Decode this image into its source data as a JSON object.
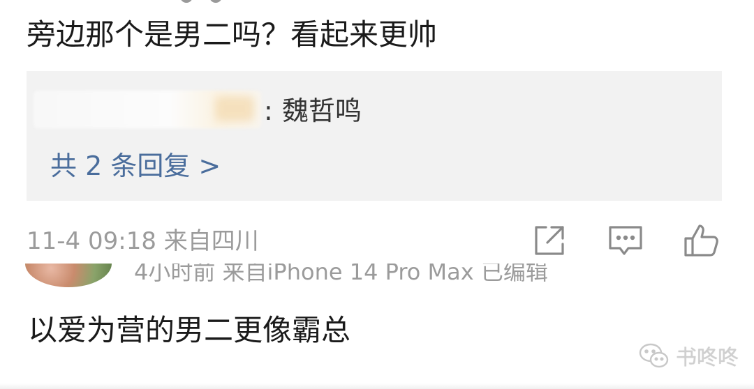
{
  "comment": {
    "text": "旁边那个是男二吗？看起来更帅",
    "reply_preview": {
      "separator": ":",
      "content": "魏哲鸣"
    },
    "reply_count_label": "共 2 条回复 >",
    "meta": "11-4 09:18  来自四川"
  },
  "actions": {
    "share_icon": "share-icon",
    "comment_icon": "comment-icon",
    "like_icon": "thumbs-up-icon"
  },
  "next_comment": {
    "meta": "4小时前  来自iPhone 14 Pro Max  已编辑",
    "text": "以爱为营的男二更像霸总"
  },
  "watermark": {
    "text": "书咚咚",
    "icon": "wechat-icon"
  },
  "colors": {
    "text_primary": "#1a1a1a",
    "text_secondary": "#9b9b9b",
    "link": "#4a6d9c",
    "reply_bg": "#f2f2f2"
  }
}
